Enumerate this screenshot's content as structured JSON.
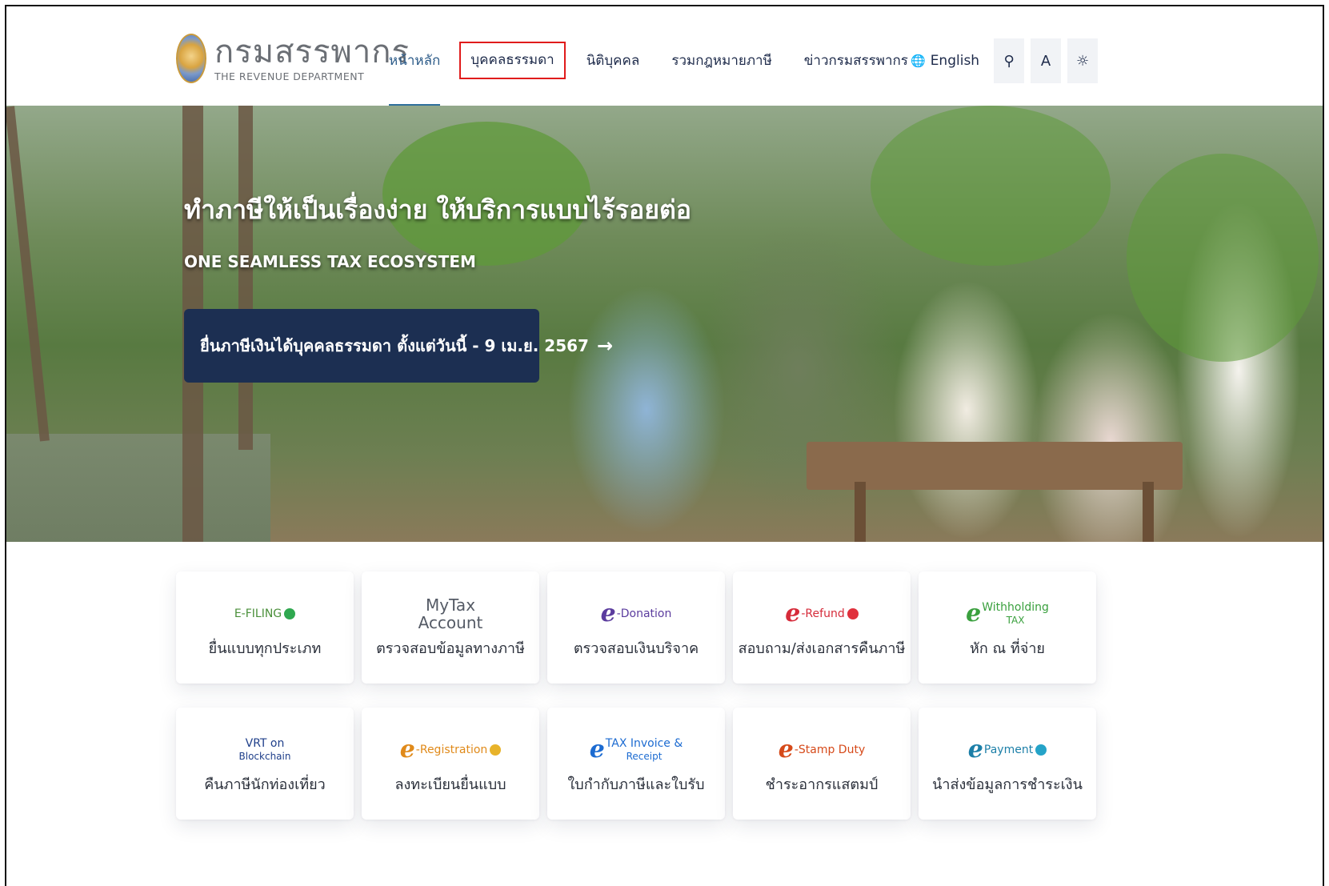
{
  "header": {
    "logo_thai": "กรมสรรพากร",
    "logo_eng": "THE REVENUE DEPARTMENT",
    "nav": [
      {
        "label": "หน้าหลัก"
      },
      {
        "label": "บุคคลธรรมดา"
      },
      {
        "label": "นิติบุคคล"
      },
      {
        "label": "รวมกฎหมายภาษี"
      },
      {
        "label": "ข่าวกรมสรรพากร"
      }
    ],
    "language": "English",
    "globe_icon": "🌐",
    "search_icon": "⚲",
    "font_size_label": "A",
    "theme_icon": "☼"
  },
  "hero": {
    "title": "ทำภาษีให้เป็นเรื่องง่าย ให้บริการแบบไร้รอยต่อ",
    "subtitle": "ONE SEAMLESS TAX ECOSYSTEM",
    "cta": "ยื่นภาษีเงินได้บุคคลธรรมดา ตั้งแต่วันนี้ - 9 เม.ย. 2567",
    "cta_arrow": "→"
  },
  "services": [
    {
      "logo": {
        "e": "",
        "main": "E-FILING",
        "sub": "",
        "color": "#4a8f3a",
        "dot": "#2fa84f"
      },
      "label": "ยื่นแบบทุกประเภท"
    },
    {
      "logo": {
        "e": "",
        "main": "MyTax",
        "sub": "Account",
        "color": "#555b66",
        "dot": ""
      },
      "label": "ตรวจสอบข้อมูลทางภาษี"
    },
    {
      "logo": {
        "e": "e",
        "main": "-Donation",
        "sub": "",
        "color": "#5b3c9e",
        "dot": ""
      },
      "label": "ตรวจสอบเงินบริจาค"
    },
    {
      "logo": {
        "e": "e",
        "main": "-Refund",
        "sub": "",
        "color": "#d62b3a",
        "dot": "#e0303c"
      },
      "label": "สอบถาม/ส่งเอกสารคืนภาษี"
    },
    {
      "logo": {
        "e": "e",
        "main": "Withholding",
        "sub": "TAX",
        "color": "#3aa03e",
        "dot": ""
      },
      "label": "หัก ณ ที่จ่าย"
    },
    {
      "logo": {
        "e": "",
        "main": "VRT on",
        "sub": "Blockchain",
        "color": "#1f3f8a",
        "dot": ""
      },
      "label": "คืนภาษีนักท่องเที่ยว"
    },
    {
      "logo": {
        "e": "e",
        "main": "-Registration",
        "sub": "",
        "color": "#e08a1a",
        "dot": "#e8b32a"
      },
      "label": "ลงทะเบียนยื่นแบบ"
    },
    {
      "logo": {
        "e": "e",
        "main": "TAX Invoice &",
        "sub": "Receipt",
        "color": "#1c6bd1",
        "dot": ""
      },
      "label": "ใบกำกับภาษีและใบรับ"
    },
    {
      "logo": {
        "e": "e",
        "main": "-Stamp Duty",
        "sub": "",
        "color": "#d64a1a",
        "dot": ""
      },
      "label": "ชำระอากรแสตมป์"
    },
    {
      "logo": {
        "e": "e",
        "main": "Payment",
        "sub": "",
        "color": "#1c7fa8",
        "dot": "#25a3c8"
      },
      "label": "นำส่งข้อมูลการชำระเงิน"
    }
  ]
}
